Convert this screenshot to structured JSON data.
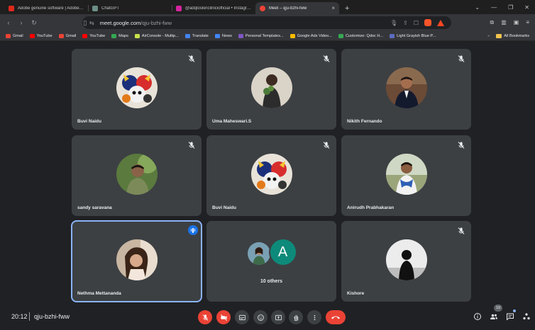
{
  "browser": {
    "tabs": [
      {
        "title": "Adobe genuine software | Adobe official",
        "favicon_color": "#e0281b",
        "active": false
      },
      {
        "title": "ChatGPT",
        "favicon_color": "#6b8f87",
        "active": false
      },
      {
        "title": "@adqloskincliniciofficial • Instagram",
        "favicon_color": "#d6249f",
        "active": false
      },
      {
        "title": "Meet – qju-bzhi-fww",
        "favicon_color": "#ea4335",
        "active": true,
        "close": "×"
      }
    ],
    "new_tab": "+",
    "url_host": "meet.google.com",
    "url_path": "/qju-bzhi-fww",
    "bookmarks": [
      {
        "label": "Gmail",
        "color": "#ea4335"
      },
      {
        "label": "YouTube",
        "color": "#ff0000"
      },
      {
        "label": "Gmail",
        "color": "#ea4335"
      },
      {
        "label": "YouTube",
        "color": "#ff0000"
      },
      {
        "label": "Maps",
        "color": "#34a853"
      },
      {
        "label": "AirConsole - Multip...",
        "color": "#c6e34b"
      },
      {
        "label": "Translate",
        "color": "#4285f4"
      },
      {
        "label": "News",
        "color": "#4285f4"
      },
      {
        "label": "Personal Templates...",
        "color": "#7e57c2"
      },
      {
        "label": "Google Ads Video...",
        "color": "#fbbc04"
      },
      {
        "label": "Customize: Qdoc H...",
        "color": "#34a853"
      },
      {
        "label": "Light Grayish Blue P...",
        "color": "#5c6bc0"
      }
    ],
    "bookmarks_more": "»",
    "all_bookmarks": "All Bookmarks"
  },
  "meet": {
    "tiles": [
      {
        "name": "Buvi Naidu",
        "avatar": "cartoon",
        "muted": true
      },
      {
        "name": "Uma Maheswari.S",
        "avatar": "woman",
        "muted": true
      },
      {
        "name": "Nikith Fernando",
        "avatar": "man-suit",
        "muted": true
      },
      {
        "name": "sandy saravana",
        "avatar": "man-green",
        "muted": true
      },
      {
        "name": "Buvi Naidu",
        "avatar": "cartoon",
        "muted": true
      },
      {
        "name": "Anirudh Prabhakaran",
        "avatar": "man-scarf",
        "muted": true
      },
      {
        "name": "Nethma Mettananda",
        "avatar": "woman-selfie",
        "muted": false,
        "speaking": true
      },
      {
        "name": "10 others",
        "avatar": "group",
        "letter": "A",
        "muted": false
      },
      {
        "name": "Kishore",
        "avatar": "silhouette",
        "muted": true
      }
    ],
    "time": "20:12",
    "meeting_code": "qju-bzhi-fww",
    "participant_count": "19",
    "colors": {
      "accent": "#8ab4f8",
      "danger": "#ea4335",
      "tile": "#3c4043",
      "bg": "#202124"
    }
  }
}
